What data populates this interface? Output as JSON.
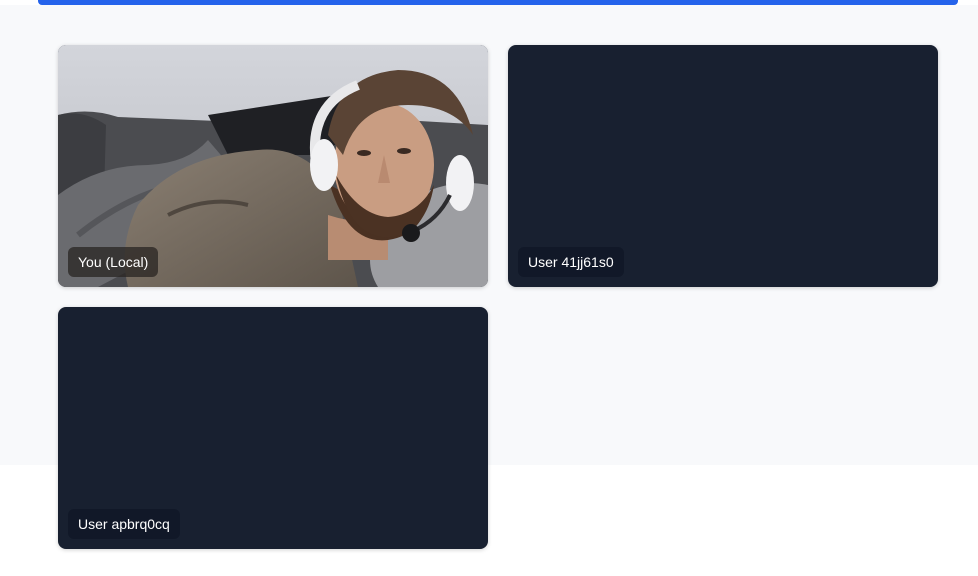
{
  "accent_color": "#2563eb",
  "tile_background": "#182030",
  "participants": [
    {
      "label": "You (Local)",
      "video": "camera-feed"
    },
    {
      "label": "User 41jj61s0",
      "video": "none"
    },
    {
      "label": "User apbrq0cq",
      "video": "none"
    }
  ]
}
